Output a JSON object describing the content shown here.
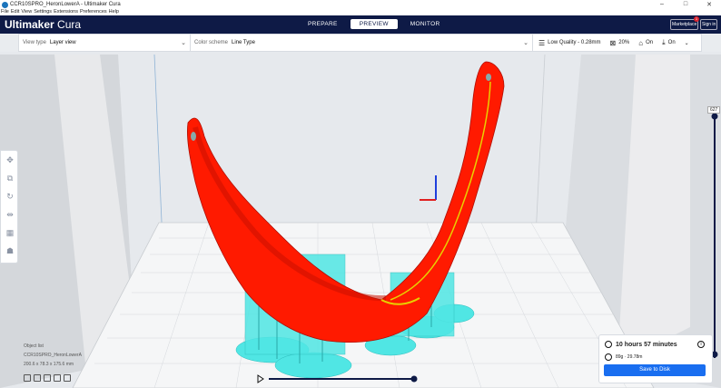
{
  "window": {
    "title": "CCR10SPRO_HeronLowerA - Ultimaker Cura"
  },
  "menu": [
    "File",
    "Edit",
    "View",
    "Settings",
    "Extensions",
    "Preferences",
    "Help"
  ],
  "header": {
    "brand_bold": "Ultimaker",
    "brand_light": "Cura",
    "tabs": [
      "PREPARE",
      "PREVIEW",
      "MONITOR"
    ],
    "active_tab": "PREVIEW",
    "marketplace": "Marketplace",
    "marketplace_badge": "1",
    "signin": "Sign in"
  },
  "toolbar": {
    "view_type_label": "View type",
    "view_type_value": "Layer view",
    "color_scheme_label": "Color scheme",
    "color_scheme_value": "Line Type",
    "quality": "Low Quality - 0.28mm",
    "infill": "20%",
    "support": "On",
    "adhesion": "On"
  },
  "layer": {
    "current": "627",
    "fraction": 1.0
  },
  "object": {
    "list_label": "Object list",
    "name": "CCR10SPRO_HeronLowerA",
    "dims": "200.6 x 78.3 x 175.6 mm"
  },
  "print": {
    "time": "10 hours 57 minutes",
    "material": "89g · 29.78m",
    "save_label": "Save to Disk"
  },
  "colors": {
    "header": "#0e1a46",
    "accent": "#196ef0",
    "model": "#ff1a00",
    "support": "#4de8e6",
    "plate": "#f3f4f5"
  }
}
